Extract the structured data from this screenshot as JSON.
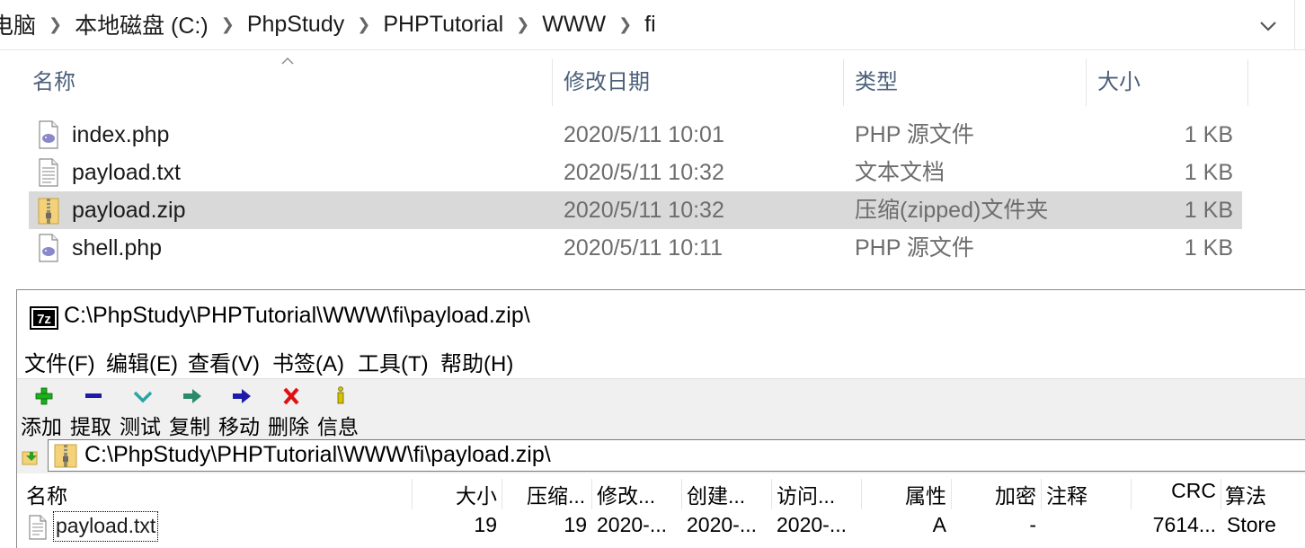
{
  "explorer": {
    "breadcrumbs": [
      "电脑",
      "本地磁盘 (C:)",
      "PhpStudy",
      "PHPTutorial",
      "WWW",
      "fi"
    ],
    "columns": {
      "name": "名称",
      "modified": "修改日期",
      "type": "类型",
      "size": "大小"
    },
    "files": [
      {
        "name": "index.php",
        "modified": "2020/5/11 10:01",
        "type": "PHP 源文件",
        "size": "1 KB",
        "icon": "php-file-icon",
        "selected": false
      },
      {
        "name": "payload.txt",
        "modified": "2020/5/11 10:32",
        "type": "文本文档",
        "size": "1 KB",
        "icon": "text-file-icon",
        "selected": false
      },
      {
        "name": "payload.zip",
        "modified": "2020/5/11 10:32",
        "type": "压缩(zipped)文件夹",
        "size": "1 KB",
        "icon": "zip-folder-icon",
        "selected": true
      },
      {
        "name": "shell.php",
        "modified": "2020/5/11 10:11",
        "type": "PHP 源文件",
        "size": "1 KB",
        "icon": "php-file-icon",
        "selected": false
      }
    ]
  },
  "sevenzip": {
    "title": "C:\\PhpStudy\\PHPTutorial\\WWW\\fi\\payload.zip\\",
    "logo_text": "7z",
    "menu": [
      "文件(F)",
      "编辑(E)",
      "查看(V)",
      "书签(A)",
      "工具(T)",
      "帮助(H)"
    ],
    "toolbar": [
      {
        "label": "添加",
        "icon": "add-icon",
        "color": "#1bb01b"
      },
      {
        "label": "提取",
        "icon": "extract-icon",
        "color": "#1c1ca8"
      },
      {
        "label": "测试",
        "icon": "test-icon",
        "color": "#2aa5a5"
      },
      {
        "label": "复制",
        "icon": "copy-icon",
        "color": "#2a8a6a"
      },
      {
        "label": "移动",
        "icon": "move-icon",
        "color": "#1c1ca8"
      },
      {
        "label": "删除",
        "icon": "delete-icon",
        "color": "#e01010"
      },
      {
        "label": "信息",
        "icon": "info-icon",
        "color": "#d4c400"
      }
    ],
    "path": "C:\\PhpStudy\\PHPTutorial\\WWW\\fi\\payload.zip\\",
    "list_columns": [
      "名称",
      "大小",
      "压缩...",
      "修改...",
      "创建...",
      "访问...",
      "属性",
      "加密",
      "注释",
      "CRC",
      "算法"
    ],
    "rows": [
      {
        "name": "payload.txt",
        "size": "19",
        "packed": "19",
        "modified": "2020-...",
        "created": "2020-...",
        "accessed": "2020-...",
        "attributes": "A",
        "encrypted": "-",
        "comment": "",
        "crc": "7614...",
        "method": "Store"
      }
    ]
  }
}
